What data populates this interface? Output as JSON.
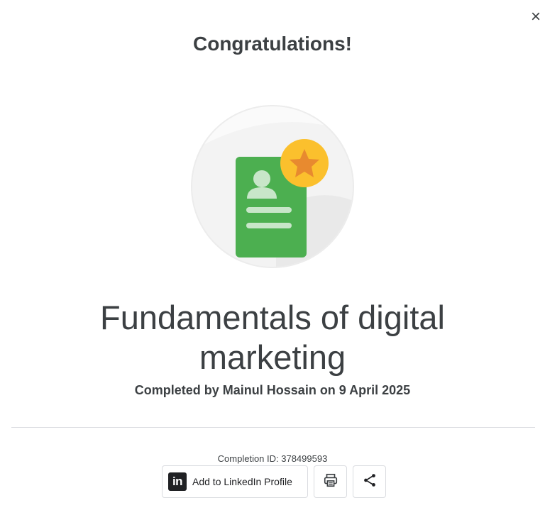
{
  "dialog": {
    "close_label": "×",
    "heading": "Congratulations!",
    "course_title": "Fundamentals of digital marketing",
    "completed_text": "Completed by Mainul Hossain on 9 April 2025",
    "completion_id": "Completion ID: 378499593"
  },
  "actions": {
    "linkedin_logo_text": "in",
    "linkedin_label": "Add to LinkedIn Profile",
    "print_icon": "printer-icon",
    "share_icon": "share-icon"
  },
  "badge": {
    "icon": "certificate-badge-icon",
    "colors": {
      "card": "#4caf50",
      "star_circle": "#fbc02d",
      "star": "#e88a2f",
      "circle_bg": "#f1f1f1"
    }
  }
}
